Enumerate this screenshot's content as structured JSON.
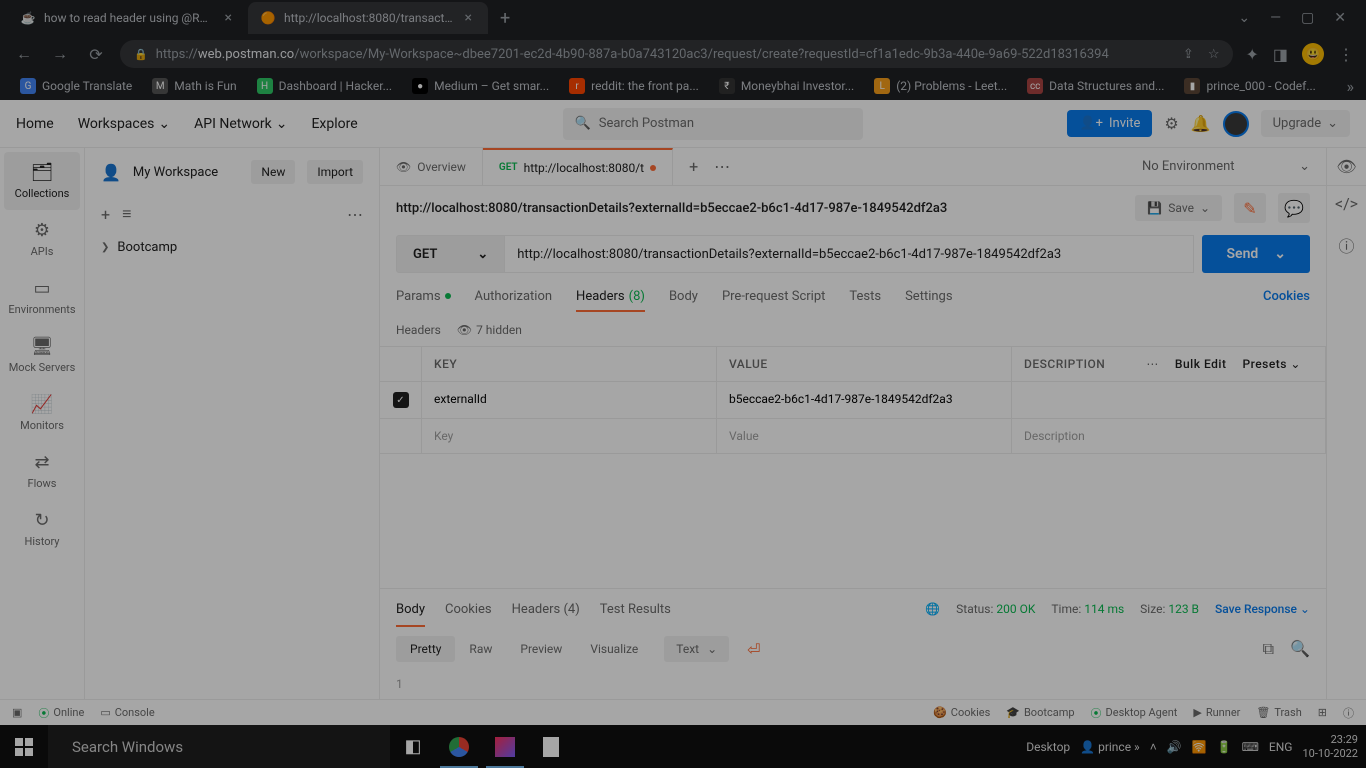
{
  "browser": {
    "tabs": [
      {
        "favicon": "☕",
        "title": "how to read header using @Req..."
      },
      {
        "favicon": "🟠",
        "title": "http://localhost:8080/transaction..."
      }
    ],
    "url_prefix": "https://",
    "url_host": "web.postman.co",
    "url_path": "/workspace/My-Workspace~dbee7201-ec2d-4b90-887a-b0a743120ac3/request/create?requestId=cf1a1edc-9b3a-440e-9a69-522d18316394",
    "bookmarks": [
      {
        "icon": "G",
        "label": "Google Translate",
        "bg": "#4285f4"
      },
      {
        "icon": "M",
        "label": "Math is Fun",
        "bg": "#555"
      },
      {
        "icon": "H",
        "label": "Dashboard | Hacker...",
        "bg": "#2ec866"
      },
      {
        "icon": "●",
        "label": "Medium – Get smar...",
        "bg": "#000"
      },
      {
        "icon": "r",
        "label": "reddit: the front pa...",
        "bg": "#ff4500"
      },
      {
        "icon": "₹",
        "label": "Moneybhai Investor...",
        "bg": "#333"
      },
      {
        "icon": "L",
        "label": "(2) Problems - Leet...",
        "bg": "#f89f1b"
      },
      {
        "icon": "cc",
        "label": "Data Structures and...",
        "bg": "#a94442"
      },
      {
        "icon": "▮",
        "label": "prince_000 - Codef...",
        "bg": "#5b4636"
      }
    ]
  },
  "postman": {
    "nav": {
      "home": "Home",
      "workspaces": "Workspaces",
      "api_network": "API Network",
      "explore": "Explore"
    },
    "search_placeholder": "Search Postman",
    "invite": "Invite",
    "upgrade": "Upgrade",
    "sidebar": [
      {
        "icon": "🗂",
        "label": "Collections",
        "active": true
      },
      {
        "icon": "⚙",
        "label": "APIs"
      },
      {
        "icon": "▭",
        "label": "Environments"
      },
      {
        "icon": "🖥",
        "label": "Mock Servers"
      },
      {
        "icon": "📈",
        "label": "Monitors"
      },
      {
        "icon": "⇄",
        "label": "Flows"
      },
      {
        "icon": "↻",
        "label": "History"
      }
    ],
    "workspace_name": "My Workspace",
    "new_btn": "New",
    "import_btn": "Import",
    "collection_item": "Bootcamp",
    "tabs": {
      "overview": "Overview",
      "req_method": "GET",
      "req_label": "http://localhost:8080/t"
    },
    "env": "No Environment",
    "request": {
      "title": "http://localhost:8080/transactionDetails?externalId=b5eccae2-b6c1-4d17-987e-1849542df2a3",
      "save": "Save",
      "method": "GET",
      "url": "http://localhost:8080/transactionDetails?externalId=b5eccae2-b6c1-4d17-987e-1849542df2a3",
      "send": "Send"
    },
    "req_tabs": {
      "params": "Params",
      "auth": "Authorization",
      "headers": "Headers",
      "headers_count": "(8)",
      "body": "Body",
      "prereq": "Pre-request Script",
      "tests": "Tests",
      "settings": "Settings",
      "cookies": "Cookies"
    },
    "headers_sub": {
      "label": "Headers",
      "hidden": "7 hidden"
    },
    "table": {
      "key_header": "KEY",
      "value_header": "VALUE",
      "desc_header": "DESCRIPTION",
      "bulk": "Bulk Edit",
      "presets": "Presets",
      "rows": [
        {
          "key": "externalId",
          "value": "b5eccae2-b6c1-4d17-987e-1849542df2a3"
        }
      ],
      "key_placeholder": "Key",
      "value_placeholder": "Value",
      "desc_placeholder": "Description"
    },
    "response": {
      "tabs": {
        "body": "Body",
        "cookies": "Cookies",
        "headers": "Headers (4)",
        "tests": "Test Results"
      },
      "status_label": "Status:",
      "status": "200 OK",
      "time_label": "Time:",
      "time": "114 ms",
      "size_label": "Size:",
      "size": "123 B",
      "save": "Save Response",
      "views": {
        "pretty": "Pretty",
        "raw": "Raw",
        "preview": "Preview",
        "visualize": "Visualize"
      },
      "lang": "Text",
      "line": "1"
    },
    "footer": {
      "online": "Online",
      "console": "Console",
      "cookies": "Cookies",
      "bootcamp": "Bootcamp",
      "agent": "Desktop Agent",
      "runner": "Runner",
      "trash": "Trash"
    }
  },
  "taskbar": {
    "search": "Search Windows",
    "desktop": "Desktop",
    "user": "prince",
    "lang": "ENG",
    "time": "23:29",
    "date": "10-10-2022"
  }
}
